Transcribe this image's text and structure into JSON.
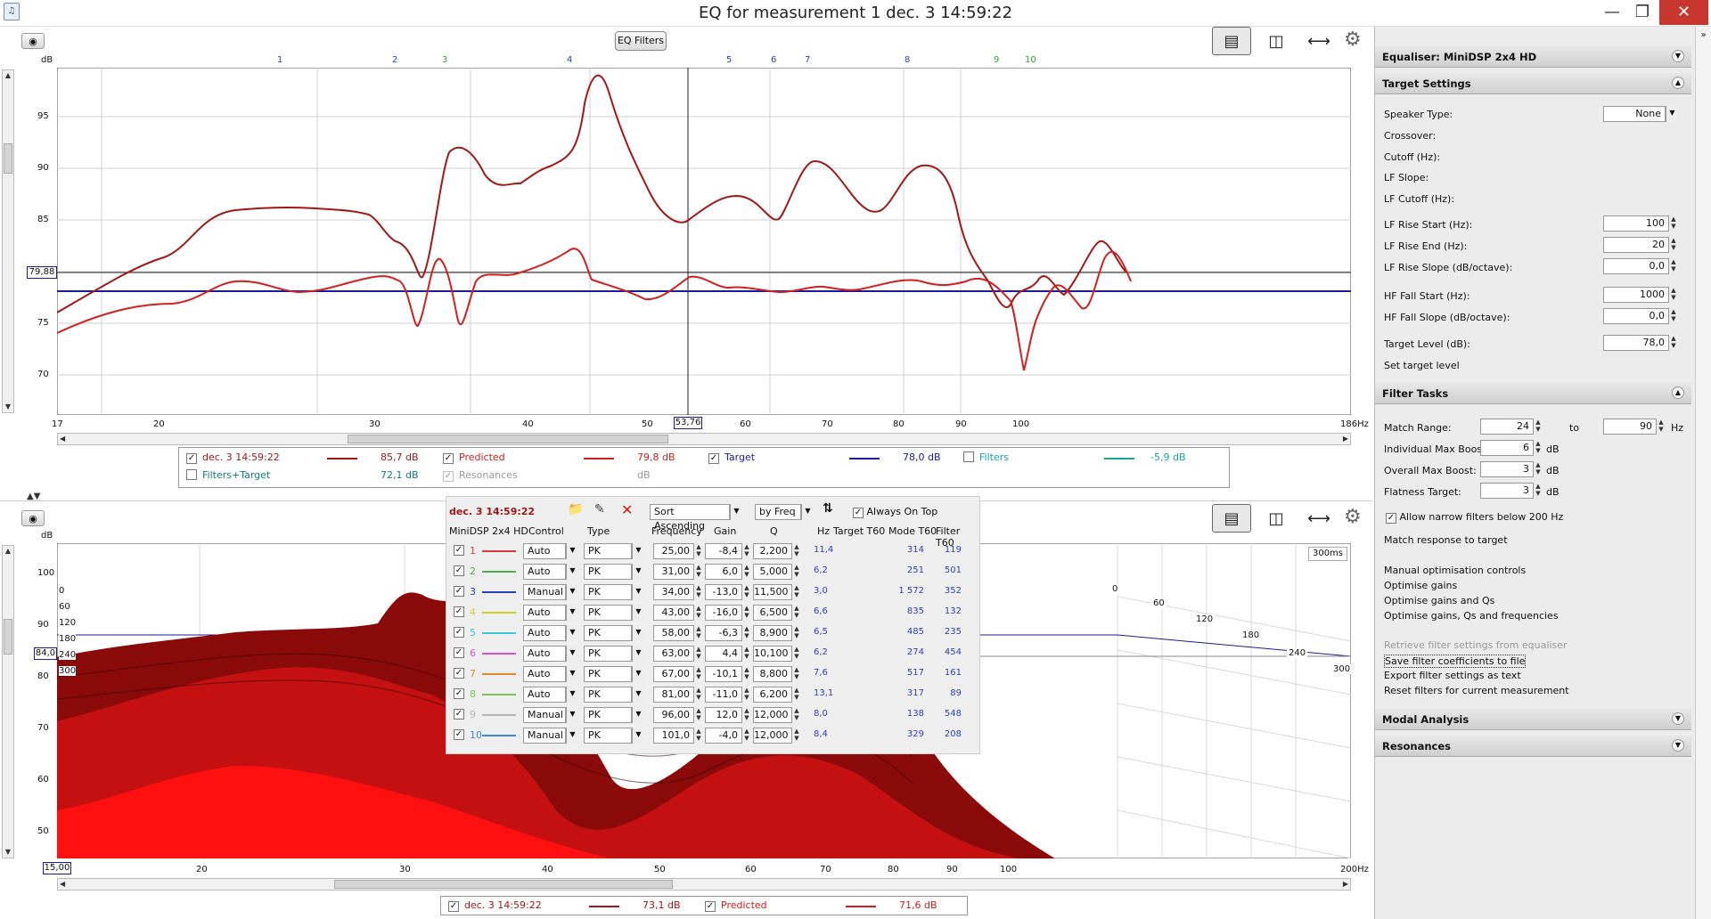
{
  "window": {
    "title": "EQ for measurement 1 dec. 3 14:59:22",
    "minimize": "—",
    "maximize": "❐",
    "close": "✕"
  },
  "top_chart": {
    "eq_filters_button": "EQ Filters",
    "db_unit": "dB",
    "y_ticks": [
      "95",
      "90",
      "85",
      "80",
      "75",
      "70"
    ],
    "x_ticks": [
      "17",
      "20",
      "30",
      "40",
      "50",
      "60",
      "70",
      "80",
      "90",
      "100",
      "186Hz"
    ],
    "cursor_x": "53,76",
    "cursor_y": "79,88",
    "filter_markers": [
      {
        "label": "1",
        "color": "#2b3fb5"
      },
      {
        "label": "2",
        "color": "#2b3fb5"
      },
      {
        "label": "3",
        "color": "#33a033"
      },
      {
        "label": "4",
        "color": "#2b3fb5"
      },
      {
        "label": "5",
        "color": "#2b3fb5"
      },
      {
        "label": "6",
        "color": "#2b3fb5"
      },
      {
        "label": "7",
        "color": "#2b3fb5"
      },
      {
        "label": "8",
        "color": "#2b3fb5"
      },
      {
        "label": "9",
        "color": "#33a033"
      },
      {
        "label": "10",
        "color": "#33a033"
      }
    ],
    "legend": [
      {
        "checked": true,
        "name": "dec. 3 14:59:22",
        "value": "85,7 dB",
        "color": "#a01818"
      },
      {
        "checked": true,
        "name": "Predicted",
        "value": "79,8 dB",
        "color": "#d22020"
      },
      {
        "checked": true,
        "name": "Target",
        "value": "78,0 dB",
        "color": "#1a1aa0"
      },
      {
        "checked": false,
        "name": "Filters",
        "value": "-5,9 dB",
        "color": "#17a3a3"
      },
      {
        "checked": false,
        "name": "Filters+Target",
        "value": "72,1 dB",
        "color": "#117a7a"
      },
      {
        "checked": true,
        "name": "Resonances",
        "value": "dB",
        "color": "#999999",
        "disabled": true
      }
    ]
  },
  "bottom_chart": {
    "db_unit": "dB",
    "y_ticks": [
      "100",
      "90",
      "80",
      "70",
      "60",
      "50"
    ],
    "x_ticks": [
      "20",
      "30",
      "40",
      "50",
      "60",
      "70",
      "80",
      "90",
      "100",
      "200Hz"
    ],
    "cursor_x": "15,00",
    "cursor_y": "84,0",
    "time_label": "300ms",
    "time_axis": [
      "0",
      "60",
      "120",
      "180",
      "240",
      "300"
    ],
    "left_time_axis": [
      "0",
      "60",
      "120",
      "180",
      "240",
      "300"
    ],
    "legend": [
      {
        "checked": true,
        "name": "dec. 3 14:59:22",
        "value": "73,1 dB",
        "color": "#a01818"
      },
      {
        "checked": true,
        "name": "Predicted",
        "value": "71,6 dB",
        "color": "#d22020"
      }
    ]
  },
  "eq_table": {
    "measurement": "dec. 3 14:59:22",
    "sort": "Sort Ascending",
    "sort_by": "by Freq",
    "always_on_top": "Always On Top",
    "headers": {
      "device": "MiniDSP 2x4 HD",
      "control": "Control",
      "type": "Type",
      "frequency": "Frequency",
      "gain": "Gain",
      "q": "Q",
      "hz": "Hz",
      "target_t60": "Target T60",
      "mode_t60": "Mode T60",
      "filter_t60": "Filter T60"
    },
    "rows": [
      {
        "n": "1",
        "color": "#d63b3b",
        "control": "Auto",
        "type": "PK",
        "freq": "25,00",
        "gain": "-8,4",
        "q": "2,200",
        "hz": "11,4",
        "target": "",
        "mode": "314",
        "filter": "119"
      },
      {
        "n": "2",
        "color": "#4caf50",
        "control": "Auto",
        "type": "PK",
        "freq": "31,00",
        "gain": "6,0",
        "q": "5,000",
        "hz": "6,2",
        "target": "",
        "mode": "251",
        "filter": "501"
      },
      {
        "n": "3",
        "color": "#2b3fb5",
        "control": "Manual",
        "type": "PK",
        "freq": "34,00",
        "gain": "-13,0",
        "q": "11,500",
        "hz": "3,0",
        "target": "",
        "mode": "1 572",
        "filter": "352"
      },
      {
        "n": "4",
        "color": "#d4cc2c",
        "control": "Auto",
        "type": "PK",
        "freq": "43,00",
        "gain": "-16,0",
        "q": "6,500",
        "hz": "6,6",
        "target": "",
        "mode": "835",
        "filter": "132"
      },
      {
        "n": "5",
        "color": "#3fc9d0",
        "control": "Auto",
        "type": "PK",
        "freq": "58,00",
        "gain": "-6,3",
        "q": "8,900",
        "hz": "6,5",
        "target": "",
        "mode": "485",
        "filter": "235"
      },
      {
        "n": "6",
        "color": "#d24fd2",
        "control": "Auto",
        "type": "PK",
        "freq": "63,00",
        "gain": "4,4",
        "q": "10,100",
        "hz": "6,2",
        "target": "",
        "mode": "274",
        "filter": "454"
      },
      {
        "n": "7",
        "color": "#e08a2e",
        "control": "Auto",
        "type": "PK",
        "freq": "67,00",
        "gain": "-10,1",
        "q": "8,800",
        "hz": "7,6",
        "target": "",
        "mode": "517",
        "filter": "161"
      },
      {
        "n": "8",
        "color": "#7bc65a",
        "control": "Auto",
        "type": "PK",
        "freq": "81,00",
        "gain": "-11,0",
        "q": "6,200",
        "hz": "13,1",
        "target": "",
        "mode": "317",
        "filter": "89"
      },
      {
        "n": "9",
        "color": "#b6b6b6",
        "control": "Manual",
        "type": "PK",
        "freq": "96,00",
        "gain": "12,0",
        "q": "12,000",
        "hz": "8,0",
        "target": "",
        "mode": "138",
        "filter": "548"
      },
      {
        "n": "10",
        "color": "#3a8ad6",
        "control": "Manual",
        "type": "PK",
        "freq": "101,0",
        "gain": "-4,0",
        "q": "12,000",
        "hz": "8,4",
        "target": "",
        "mode": "329",
        "filter": "208"
      }
    ]
  },
  "right_panel": {
    "equaliser": "Equaliser: MiniDSP 2x4 HD",
    "target_settings": "Target Settings",
    "speaker_type_label": "Speaker Type:",
    "speaker_type_value": "None",
    "crossover": "Crossover:",
    "cutoff": "Cutoff (Hz):",
    "lf_slope": "LF Slope:",
    "lf_cutoff": "LF Cutoff (Hz):",
    "fields": [
      {
        "label": "LF Rise Start (Hz):",
        "value": "100"
      },
      {
        "label": "LF Rise End (Hz):",
        "value": "20"
      },
      {
        "label": "LF Rise Slope (dB/octave):",
        "value": "0,0"
      },
      {
        "label": "HF Fall Start (Hz):",
        "value": "1000"
      },
      {
        "label": "HF Fall Slope (dB/octave):",
        "value": "0,0"
      },
      {
        "label": "Target Level (dB):",
        "value": "78,0"
      }
    ],
    "set_target_level": "Set target level",
    "filter_tasks": "Filter Tasks",
    "match_range_label": "Match Range:",
    "match_range_from": "24",
    "match_range_to_label": "to",
    "match_range_to": "90",
    "hz": "Hz",
    "db": "dB",
    "individual_max_boost_label": "Individual Max Boost:",
    "individual_max_boost": "6",
    "overall_max_boost_label": "Overall Max Boost:",
    "overall_max_boost": "3",
    "flatness_target_label": "Flatness Target:",
    "flatness_target": "3",
    "allow_narrow": "Allow narrow filters below 200 Hz",
    "match_response": "Match response to target",
    "manual_opt": "Manual optimisation controls",
    "optimise_gains": "Optimise gains",
    "optimise_gains_qs": "Optimise gains and Qs",
    "optimise_all": "Optimise gains, Qs and frequencies",
    "retrieve": "Retrieve filter settings from equaliser",
    "save_coeff": "Save filter coefficients to file",
    "export": "Export filter settings as text",
    "reset": "Reset filters for current measurement",
    "modal_analysis": "Modal Analysis",
    "resonances": "Resonances"
  }
}
